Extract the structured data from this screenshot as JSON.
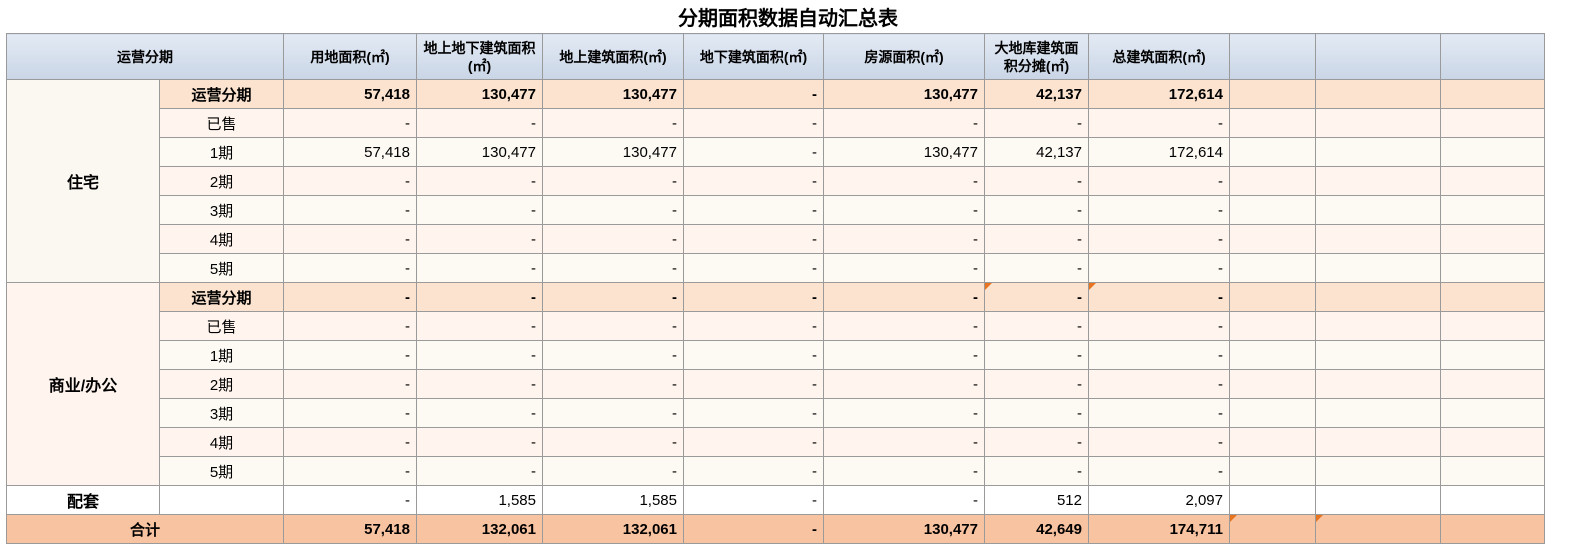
{
  "title": "分期面积数据自动汇总表",
  "header": {
    "group": "运营分期",
    "cols": [
      "用地面积(㎡)",
      "地上地下建筑面积(㎡)",
      "地上建筑面积(㎡)",
      "地下建筑面积(㎡)",
      "房源面积(㎡)",
      "大地库建筑面积分摊(㎡)",
      "总建筑面积(㎡)"
    ]
  },
  "groups": [
    {
      "name": "住宅",
      "rows": [
        {
          "label": "运营分期",
          "values": [
            "57,418",
            "130,477",
            "130,477",
            "-",
            "130,477",
            "42,137",
            "172,614"
          ]
        },
        {
          "label": "已售",
          "values": [
            "-",
            "-",
            "-",
            "-",
            "-",
            "-",
            "-"
          ]
        },
        {
          "label": "1期",
          "values": [
            "57,418",
            "130,477",
            "130,477",
            "-",
            "130,477",
            "42,137",
            "172,614"
          ]
        },
        {
          "label": "2期",
          "values": [
            "-",
            "-",
            "-",
            "-",
            "-",
            "-",
            "-"
          ]
        },
        {
          "label": "3期",
          "values": [
            "-",
            "-",
            "-",
            "-",
            "-",
            "-",
            "-"
          ]
        },
        {
          "label": "4期",
          "values": [
            "-",
            "-",
            "-",
            "-",
            "-",
            "-",
            "-"
          ]
        },
        {
          "label": "5期",
          "values": [
            "-",
            "-",
            "-",
            "-",
            "-",
            "-",
            "-"
          ]
        }
      ]
    },
    {
      "name": "商业/办公",
      "rows": [
        {
          "label": "运营分期",
          "values": [
            "-",
            "-",
            "-",
            "-",
            "-",
            "-",
            "-"
          ]
        },
        {
          "label": "已售",
          "values": [
            "-",
            "-",
            "-",
            "-",
            "-",
            "-",
            "-"
          ]
        },
        {
          "label": "1期",
          "values": [
            "-",
            "-",
            "-",
            "-",
            "-",
            "-",
            "-"
          ]
        },
        {
          "label": "2期",
          "values": [
            "-",
            "-",
            "-",
            "-",
            "-",
            "-",
            "-"
          ]
        },
        {
          "label": "3期",
          "values": [
            "-",
            "-",
            "-",
            "-",
            "-",
            "-",
            "-"
          ]
        },
        {
          "label": "4期",
          "values": [
            "-",
            "-",
            "-",
            "-",
            "-",
            "-",
            "-"
          ]
        },
        {
          "label": "5期",
          "values": [
            "-",
            "-",
            "-",
            "-",
            "-",
            "-",
            "-"
          ]
        }
      ]
    }
  ],
  "peitao": {
    "name": "配套",
    "values": [
      "-",
      "1,585",
      "1,585",
      "-",
      "-",
      "512",
      "2,097"
    ]
  },
  "total": {
    "label": "合计",
    "values": [
      "57,418",
      "132,061",
      "132,061",
      "-",
      "130,477",
      "42,649",
      "174,711"
    ]
  },
  "colors": {
    "header": "#c9d5e6",
    "subtotal": "#fbe3cf",
    "total": "#f8c3a0",
    "comment_marker": "#e8741f"
  }
}
